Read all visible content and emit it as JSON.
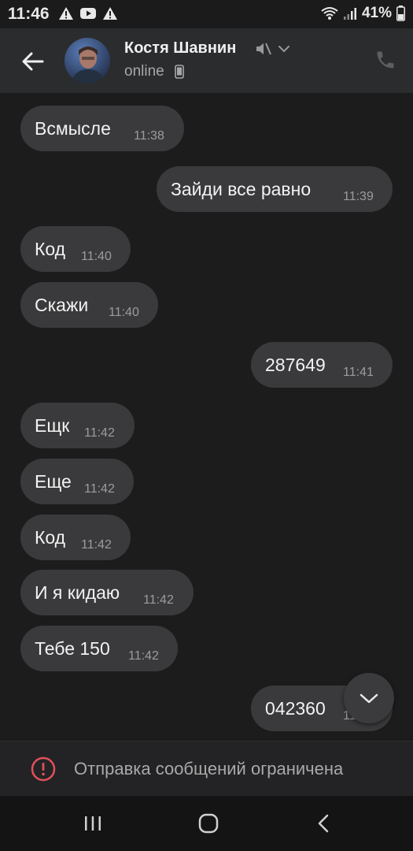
{
  "status_bar": {
    "time": "11:46",
    "battery": "41%",
    "icons": [
      "warning-icon",
      "youtube-icon",
      "warning-icon",
      "wifi-icon",
      "signal-icon",
      "battery-icon"
    ]
  },
  "header": {
    "contact_name": "Костя Шавнин",
    "status": "online",
    "icons": [
      "back-arrow-icon",
      "mute-icon",
      "chevron-down-icon",
      "phone-device-icon",
      "call-icon"
    ]
  },
  "messages": [
    {
      "side": "in",
      "text": "Всмысле",
      "time": "11:38"
    },
    {
      "side": "out",
      "text": "Зайди все равно",
      "time": "11:39"
    },
    {
      "side": "in",
      "text": "Код",
      "time": "11:40"
    },
    {
      "side": "in",
      "text": "Скажи",
      "time": "11:40"
    },
    {
      "side": "out",
      "text": "287649",
      "time": "11:41"
    },
    {
      "side": "in",
      "text": "Ещк",
      "time": "11:42"
    },
    {
      "side": "in",
      "text": "Еще",
      "time": "11:42"
    },
    {
      "side": "in",
      "text": "Код",
      "time": "11:42"
    },
    {
      "side": "in",
      "text": "И я кидаю",
      "time": "11:42"
    },
    {
      "side": "in",
      "text": "Тебе 150",
      "time": "11:42"
    },
    {
      "side": "out",
      "text": "042360",
      "time": "11:42"
    }
  ],
  "footer": {
    "restriction_text": "Отправка сообщений ограничена"
  },
  "colors": {
    "background": "#1c1c1c",
    "header": "#2b2c2e",
    "bubble": "#3a3a3c",
    "alert": "#e0505a"
  }
}
